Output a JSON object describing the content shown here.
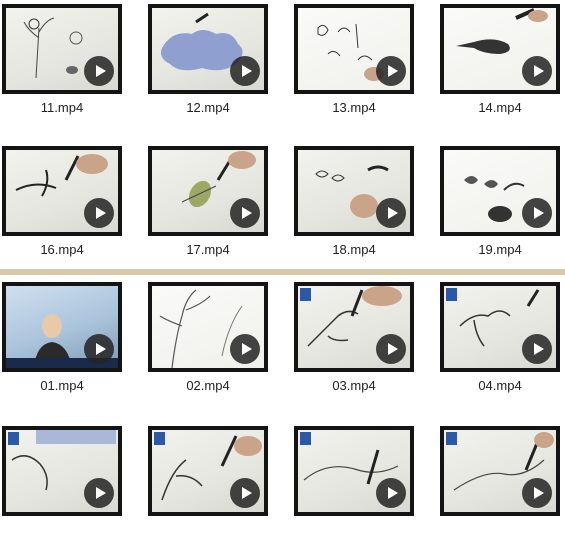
{
  "section_top": {
    "files": [
      {
        "name": "11.mp4",
        "thumb_icon": "video-thumbnail-icon"
      },
      {
        "name": "12.mp4",
        "thumb_icon": "video-thumbnail-icon"
      },
      {
        "name": "13.mp4",
        "thumb_icon": "video-thumbnail-icon"
      },
      {
        "name": "14.mp4",
        "thumb_icon": "video-thumbnail-icon"
      },
      {
        "name": "16.mp4",
        "thumb_icon": "video-thumbnail-icon"
      },
      {
        "name": "17.mp4",
        "thumb_icon": "video-thumbnail-icon"
      },
      {
        "name": "18.mp4",
        "thumb_icon": "video-thumbnail-icon"
      },
      {
        "name": "19.mp4",
        "thumb_icon": "video-thumbnail-icon"
      }
    ]
  },
  "section_bottom": {
    "files": [
      {
        "name": "01.mp4",
        "thumb_icon": "video-thumbnail-icon"
      },
      {
        "name": "02.mp4",
        "thumb_icon": "video-thumbnail-icon"
      },
      {
        "name": "03.mp4",
        "thumb_icon": "video-thumbnail-icon"
      },
      {
        "name": "04.mp4",
        "thumb_icon": "video-thumbnail-icon"
      },
      {
        "name": "",
        "thumb_icon": "video-thumbnail-icon"
      },
      {
        "name": "",
        "thumb_icon": "video-thumbnail-icon"
      },
      {
        "name": "",
        "thumb_icon": "video-thumbnail-icon"
      },
      {
        "name": "",
        "thumb_icon": "video-thumbnail-icon"
      }
    ]
  },
  "play_icon": "play-icon",
  "divider_color": "#d8c9a8"
}
